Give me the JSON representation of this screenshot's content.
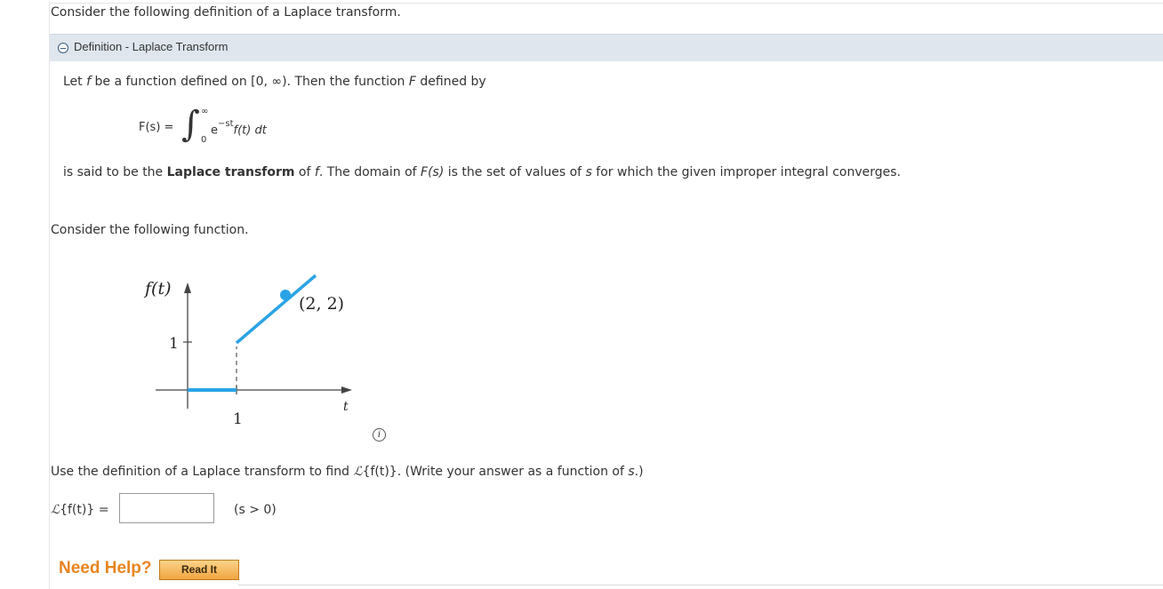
{
  "intro": "Consider the following definition of a Laplace transform.",
  "definition": {
    "title": "Definition - Laplace Transform",
    "line1_a": "Let ",
    "line1_f": "f",
    "line1_b": " be a function defined on [0, ∞). Then the function ",
    "line1_F": "F",
    "line1_c": " defined by",
    "eq_lhs": "F(s) =",
    "eq_integral": "∫",
    "eq_upper": "∞",
    "eq_lower": "0",
    "eq_e": "e",
    "eq_exp": "−st",
    "eq_rest": "f(t) dt",
    "line2_a": "is said to be the ",
    "line2_bold": "Laplace transform",
    "line2_b": " of ",
    "line2_f": "f",
    "line2_c": ". The domain of ",
    "line2_Fs": "F(s)",
    "line2_d": " is the set of values of ",
    "line2_s": "s",
    "line2_e": " for which the given improper integral converges."
  },
  "function_intro": "Consider the following function.",
  "graph": {
    "y_axis_label": "f(t)",
    "x_axis_label": "t",
    "y_tick": "1",
    "x_tick": "1",
    "point_label": "(2, 2)",
    "line_color": "#2aa3e6"
  },
  "question": {
    "a": "Use the definition of a Laplace transform to find ",
    "L": "ℒ",
    "b": "{f(t)}",
    "c": ". (Write your answer as a function of ",
    "s": "s",
    "d": ".)"
  },
  "answer": {
    "L": "ℒ",
    "label": "{f(t)} =",
    "value": "",
    "condition": "(s > 0)"
  },
  "help": {
    "need_help": "Need Help?",
    "read_it": "Read It"
  },
  "info_icon": "info-icon"
}
